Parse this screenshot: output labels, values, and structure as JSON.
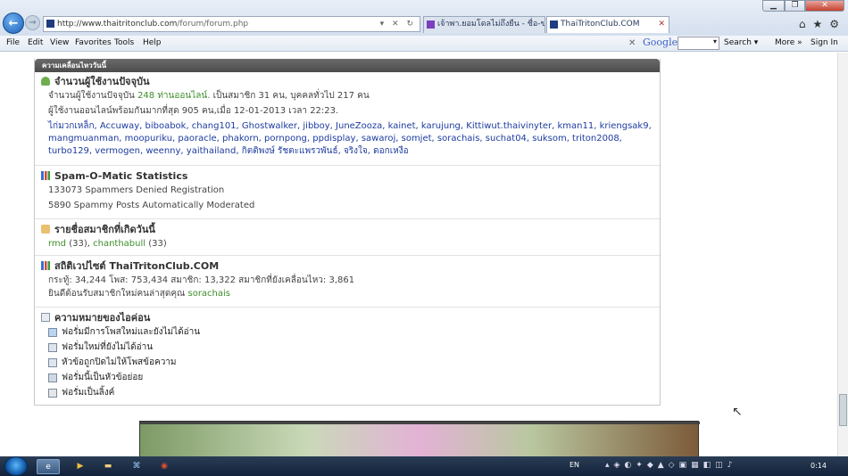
{
  "browser": {
    "url_host": "http://www.thaitritonclub.com",
    "url_path": "/forum/forum.php",
    "url_controls": "▾ ✕ ↻",
    "tabs": [
      {
        "label": "เจ้าพา.ยอมโดลไม่ถึงยืน - ชื่อ-ขาย..."
      },
      {
        "label": "ThaiTritonClub.COM"
      }
    ],
    "menu": [
      "File",
      "Edit",
      "View",
      "Favorites",
      "Tools",
      "Help"
    ],
    "google": {
      "label": "Google",
      "search": "Search ▾",
      "more": "More »",
      "sign_in": "Sign In"
    }
  },
  "forum": {
    "header": "ความเคลื่อนไหววันนี้",
    "online": {
      "title": "จำนวนผู้ใช้งานปัจจุบัน",
      "line1_a": "จำนวนผู้ใช้งานปัจจุบัน ",
      "line1_b": "248 ท่านออนไลน์.",
      "line1_c": " เป็นสมาชิก 31 คน, บุคคลทั่วไป 217 คน",
      "line2": "ผู้ใช้งานออนไลน์พร้อมกันมากที่สุด 905 คน,เมื่อ 12-01-2013 เวลา 22:23.",
      "members_row1": "ไก่มวกเหล็ก, Accuway, biboabok, chang101, Ghostwalker, jibboy, JuneZooza, kainet, karujung, Kittiwut.thaivinyter, kman11, kriengsak9,",
      "members_row2": "mangmuanman, moopuriku, paoracle, phakorn, pornpong, ppdisplay, sawaroj, somjet, sorachais, suchat04, suksom, triton2008,",
      "members_row3": "turbo129, vermogen, weenny, yaithailand, กิตติพงษ์ รัชตะแพรวพันธ์, จริงใจ, ดอกเหงือ"
    },
    "spam": {
      "title": "Spam-O-Matic Statistics",
      "line1": "133073 Spammers Denied Registration",
      "line2": "5890 Spammy Posts Automatically Moderated"
    },
    "birthday": {
      "title": "รายชื่อสมาชิกที่เกิดวันนี้",
      "name1": "rmd",
      "age1": " (33), ",
      "name2": "chanthabull",
      "age2": " (33)"
    },
    "stats": {
      "title": "สถิติเวปไซต์ ThaiTritonClub.COM",
      "line1": "กระทู้: 34,244  โพส: 753,434  สมาชิก: 13,322  สมาชิกที่ยังเคลื่อนไหว: 3,861",
      "welcome": "ยินดีต้อนรับสมาชิกใหม่คนล่าสุดคุณ ",
      "newest": "sorachais"
    },
    "icons": {
      "title": "ความหมายของไอค่อน",
      "items": [
        "ฟอรั่มมีการโพสใหม่และยังไม่ได้อ่าน",
        "ฟอรั่มใหม่ที่ยังไม่ได้อ่าน",
        "หัวข้อถูกปิดไม่ให้โพสข้อความ",
        "ฟอรั่มนี้เป็นหัวข้อย่อย",
        "ฟอรั่มเป็นลิ้งค์"
      ]
    }
  },
  "taskbar": {
    "lang": "EN",
    "clock": "0:14"
  },
  "colors": {
    "accent_green": "#3d8f2a",
    "link_blue": "#1d3ba0",
    "header_gray": "#555555"
  }
}
